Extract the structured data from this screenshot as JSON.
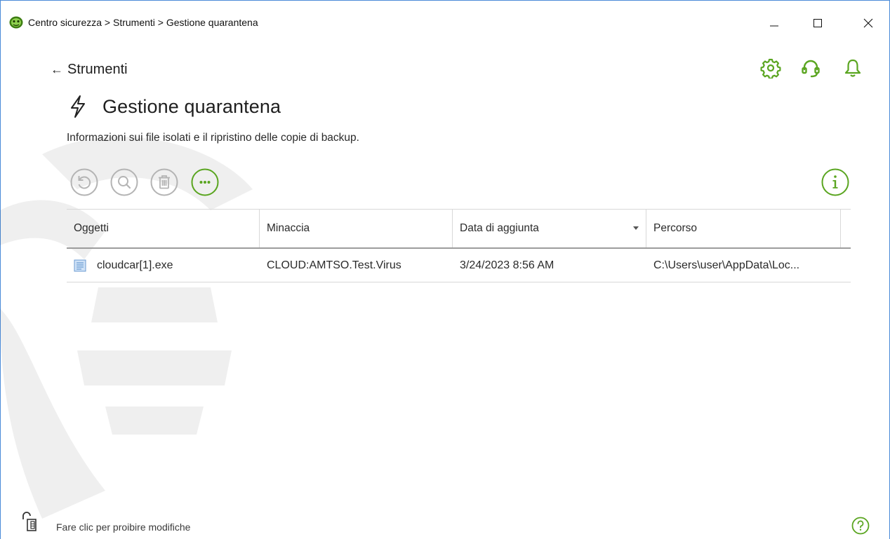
{
  "window": {
    "title": "Centro sicurezza > Strumenti > Gestione quarantena",
    "controls": [
      "minimize",
      "maximize",
      "close"
    ]
  },
  "header": {
    "back_label": "Strumenti",
    "icons": [
      "gear-icon",
      "headset-icon",
      "bell-icon"
    ]
  },
  "page": {
    "title": "Gestione quarantena",
    "subtitle": "Informazioni sui file isolati e il ripristino delle copie di backup."
  },
  "toolbar": {
    "buttons": [
      {
        "name": "restore",
        "icon": "restore-icon",
        "enabled": false
      },
      {
        "name": "scan",
        "icon": "search-icon",
        "enabled": false
      },
      {
        "name": "delete",
        "icon": "trash-icon",
        "enabled": false
      },
      {
        "name": "more",
        "icon": "more-icon",
        "enabled": true
      }
    ],
    "info_icon": "info-icon"
  },
  "table": {
    "columns": [
      "Oggetti",
      "Minaccia",
      "Data di aggiunta",
      "Percorso"
    ],
    "sorted_column": "Data di aggiunta",
    "rows": [
      {
        "object": "cloudcar[1].exe",
        "threat": "CLOUD:AMTSO.Test.Virus",
        "date": "3/24/2023 8:56 AM",
        "path": "C:\\Users\\user\\AppData\\Loc..."
      }
    ]
  },
  "footer": {
    "lock_label": "Fare clic per proibire modifiche",
    "help_icon": "help-icon"
  },
  "colors": {
    "accent": "#5aa520",
    "disabled": "#b4b4b4",
    "border": "#d8d8d8"
  }
}
